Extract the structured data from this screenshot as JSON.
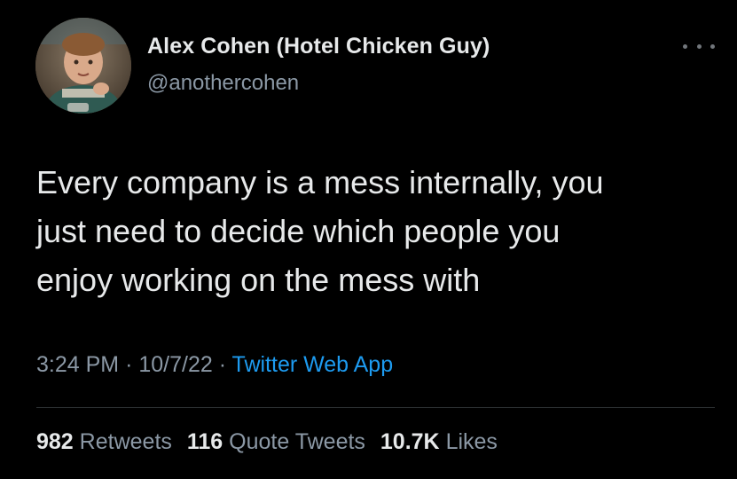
{
  "author": {
    "display_name": "Alex Cohen (Hotel Chicken Guy)",
    "handle": "@anothercohen"
  },
  "tweet": {
    "lines": [
      "Every company is a mess internally, you",
      "just need to decide which people you",
      "enjoy working on the mess with"
    ],
    "time": "3:24 PM",
    "date": "10/7/22",
    "separator": "·",
    "source": "Twitter Web App"
  },
  "stats": {
    "retweets_count": "982",
    "retweets_label": "Retweets",
    "quote_tweets_count": "116",
    "quote_tweets_label": "Quote Tweets",
    "likes_count": "10.7K",
    "likes_label": "Likes"
  },
  "icons": {
    "more": "more-horizontal-icon"
  },
  "colors": {
    "background": "#000000",
    "primary_text": "#e7e9ea",
    "secondary_text": "#8b98a5",
    "link": "#1d9bf0",
    "divider": "#2f3336"
  }
}
